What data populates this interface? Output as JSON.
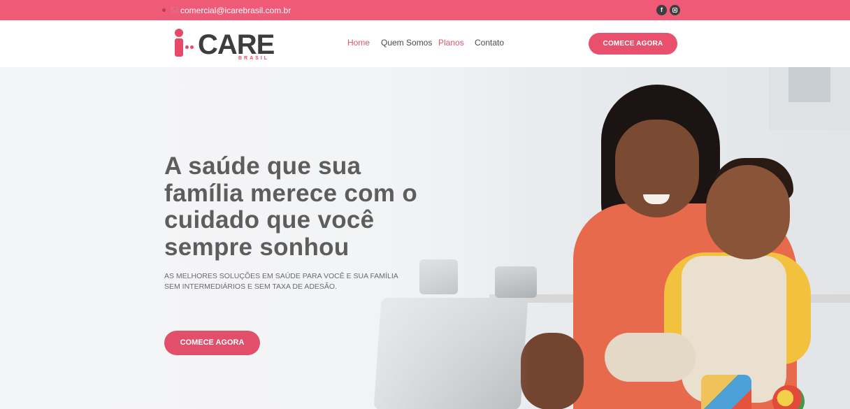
{
  "topbar": {
    "email": "comercial@icarebrasil.com.br",
    "social": [
      {
        "icon": "facebook-icon",
        "glyph": "f"
      },
      {
        "icon": "instagram-icon"
      }
    ],
    "background": "#ef5b76"
  },
  "header": {
    "logo": {
      "word": "CARE",
      "sub": "BRASIL",
      "mark": "i-"
    },
    "nav": [
      {
        "label": "Home",
        "active": true
      },
      {
        "label": "Quem Somos",
        "active": false
      },
      {
        "label": "Planos",
        "active": true
      },
      {
        "label": "Contato",
        "active": false
      }
    ],
    "cta_label": "COMECE AGORA"
  },
  "hero": {
    "title": "A saúde que sua família merece com o cuidado que você sempre sonhou",
    "subtitle": "AS MELHORES SOLUÇÕES EM SAÚDE  PARA VOCÊ E SUA FAMÍLIA SEM INTERMEDIÁRIOS E SEM TAXA DE ADESÃO.",
    "cta_label": "COMECE AGORA"
  },
  "colors": {
    "accent": "#e9506c",
    "heading": "#5d5d5d"
  }
}
